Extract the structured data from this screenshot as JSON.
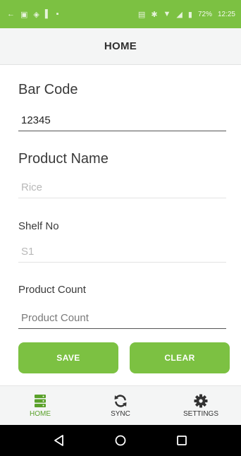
{
  "status_bar": {
    "battery": "72%",
    "time": "12:25"
  },
  "header": {
    "title": "HOME"
  },
  "form": {
    "barcode": {
      "label": "Bar Code",
      "value": "12345"
    },
    "product_name": {
      "label": "Product Name",
      "value": "",
      "placeholder": "Rice"
    },
    "shelf_no": {
      "label": "Shelf No",
      "value": "",
      "placeholder": "S1"
    },
    "product_count": {
      "label": "Product Count",
      "value": "",
      "placeholder": "Product Count"
    }
  },
  "buttons": {
    "save": "SAVE",
    "clear": "CLEAR"
  },
  "tabs": [
    {
      "label": "HOME",
      "icon": "server-icon",
      "active": true
    },
    {
      "label": "SYNC",
      "icon": "sync-icon",
      "active": false
    },
    {
      "label": "SETTINGS",
      "icon": "gear-icon",
      "active": false
    }
  ],
  "colors": {
    "accent": "#7cc142",
    "active_tab": "#5aa12a"
  },
  "nav": {
    "back": "back-icon",
    "home": "home-icon",
    "recents": "recents-icon"
  }
}
